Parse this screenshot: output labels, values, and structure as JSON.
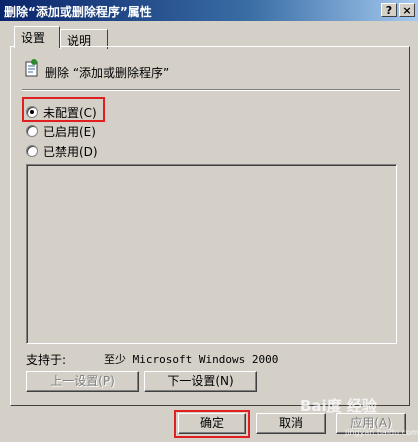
{
  "window": {
    "title": "删除“添加或删除程序”属性",
    "help_glyph": "?",
    "close_glyph": "×"
  },
  "tabs": [
    {
      "label": "设置",
      "active": true
    },
    {
      "label": "说明",
      "active": false
    }
  ],
  "policy": {
    "icon": "policy-document-icon",
    "title": "删除 “添加或删除程序”"
  },
  "options": [
    {
      "label": "未配置(C)",
      "checked": true
    },
    {
      "label": "已启用(E)",
      "checked": false
    },
    {
      "label": "已禁用(D)",
      "checked": false
    }
  ],
  "supported": {
    "label": "支持于:",
    "value": "至少 Microsoft Windows 2000"
  },
  "nav_buttons": {
    "prev": "上一设置(P)",
    "next": "下一设置(N)"
  },
  "dialog_buttons": {
    "ok": "确定",
    "cancel": "取消",
    "apply": "应用(A)"
  },
  "watermark": {
    "text": "Bai度 经验",
    "sub": "jingyan.baidu.com"
  },
  "colors": {
    "highlight": "#e02020",
    "title_bar": "#0a246a",
    "face": "#d4d0c8"
  }
}
